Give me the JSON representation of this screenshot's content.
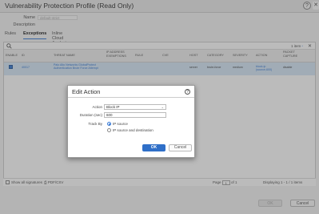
{
  "window": {
    "title": "Vulnerability Protection Profile (Read Only)",
    "help_icon": "help-icon",
    "close_icon": "close-icon"
  },
  "form": {
    "name_label": "Name",
    "name_value": "default-strict",
    "description_label": "Description"
  },
  "tabs": [
    {
      "label": "Rules"
    },
    {
      "label": "Exceptions"
    },
    {
      "label": "Inline Cloud Analysis"
    }
  ],
  "search": {
    "icon": "search-icon",
    "count": "1 item",
    "clear": "✕"
  },
  "table": {
    "headers": [
      "ENABLE",
      "ID",
      "THREAT NAME",
      "IP ADDRESS EXEMPTIONS",
      "RULE",
      "CVE",
      "HOST",
      "CATEGORY",
      "SEVERITY",
      "ACTION",
      "PACKET CAPTURE"
    ],
    "rows": [
      {
        "enabled": true,
        "id": "40017",
        "threat_name": "Palo Alto Networks GlobalProtect Authentication Brute Force Attempt",
        "ip_exemptions": "",
        "rule": "",
        "cve": "",
        "host": "server",
        "category": "brute-force",
        "severity": "medium",
        "action": "block-ip (source,600)",
        "packet_capture": "disable"
      }
    ]
  },
  "footer": {
    "show_all": "Show all signatures",
    "pdf": "PDF/CSV",
    "page_label": "Page",
    "page_value": "1",
    "page_total": "of 1",
    "display": "Displaying 1 - 1 / 1 items"
  },
  "buttons": {
    "ok": "OK",
    "cancel": "Cancel"
  },
  "dialog": {
    "title": "Edit Action",
    "action_label": "Action",
    "action_value": "Block IP",
    "duration_label": "Duration (sec)",
    "duration_value": "600",
    "track_by_label": "Track By",
    "options": [
      {
        "label": "IP source",
        "selected": true
      },
      {
        "label": "IP source and destination",
        "selected": false
      }
    ],
    "ok": "OK",
    "cancel": "Cancel"
  },
  "colors": {
    "accent": "#3a7bd5",
    "selected_row": "#d7e8f8",
    "primary_button": "#2f6fc8"
  }
}
